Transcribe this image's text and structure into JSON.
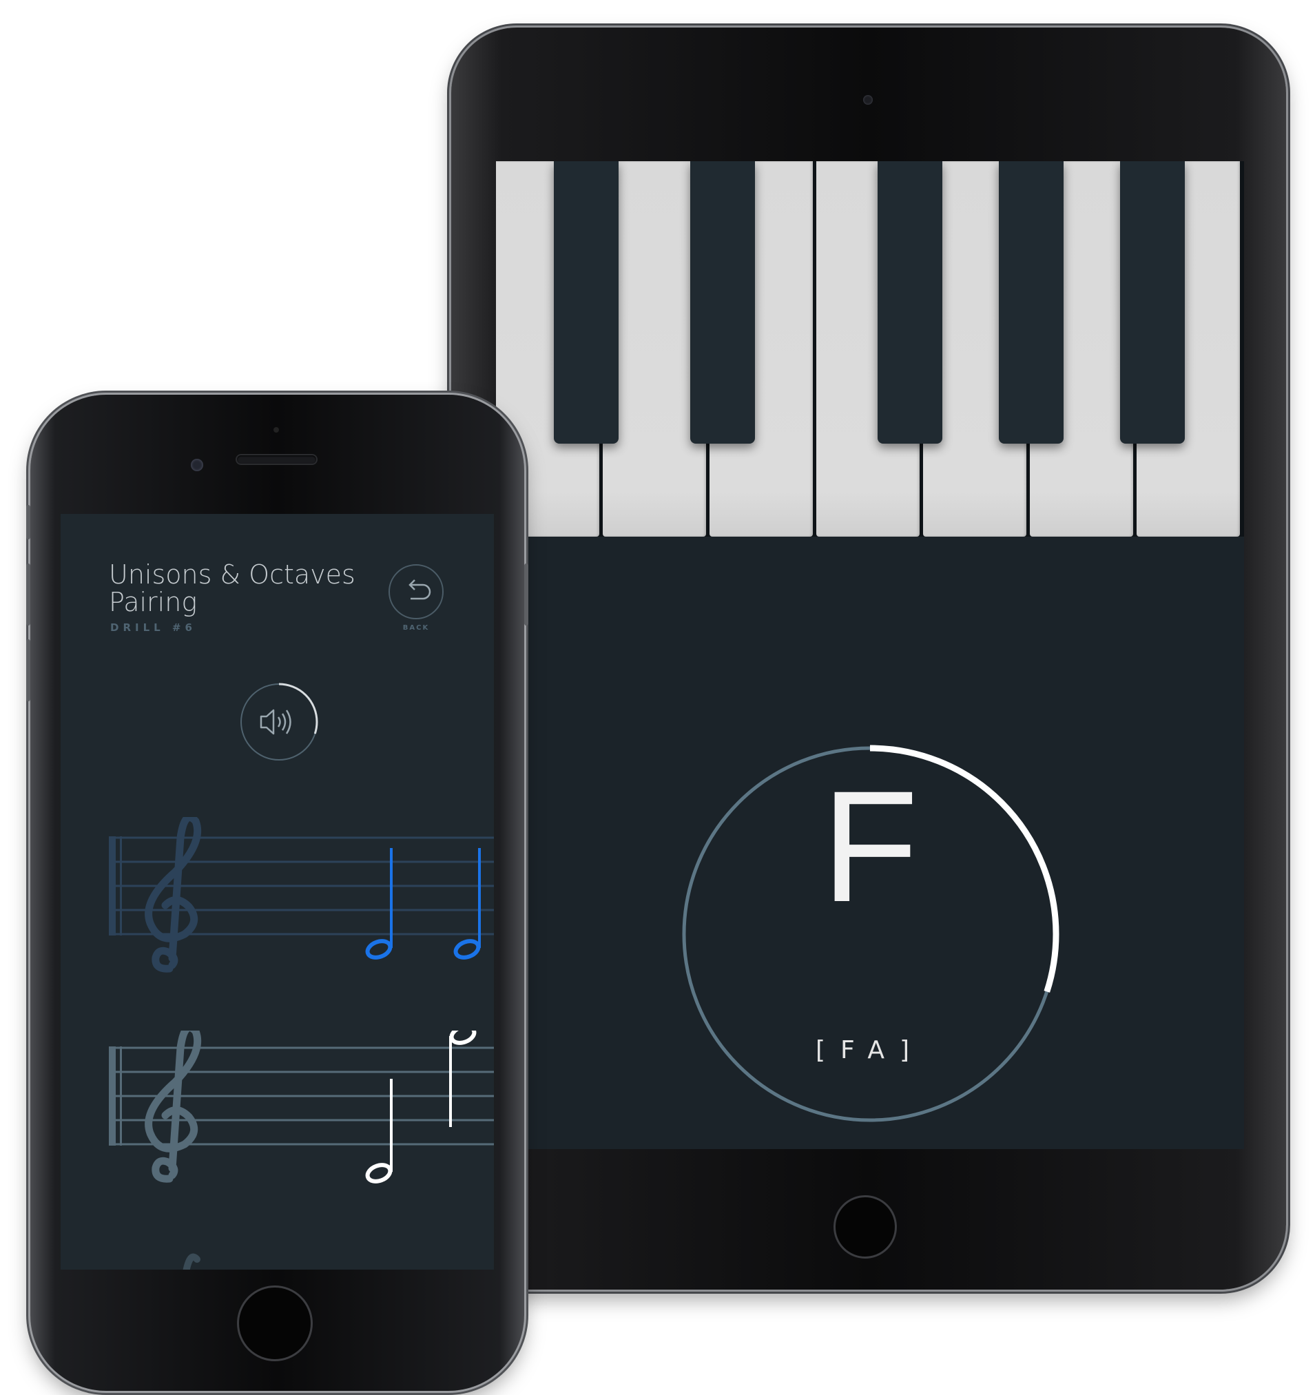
{
  "tablet": {
    "note_letter": "F",
    "solfege": "[FA]",
    "progress_fraction": 0.3,
    "colors": {
      "ring_track": "#5c7685",
      "ring_progress": "#ffffff",
      "screen_bg": "#1b2329",
      "white_key": "#dcdcdc",
      "black_key": "#202a31"
    }
  },
  "phone": {
    "title_line1": "Unisons & Octaves",
    "title_line2": "Pairing",
    "subtitle": "DRILL #6",
    "back_label": "BACK",
    "back_icon": "undo-arrow-icon",
    "sound_icon": "speaker-icon",
    "sound_progress_fraction": 0.3,
    "colors": {
      "screen_bg": "#1f282e",
      "active_note": "#1a73e8",
      "staff_dim": "#2c4259",
      "staff_mid": "#566b78",
      "note_white": "#ffffff"
    }
  }
}
